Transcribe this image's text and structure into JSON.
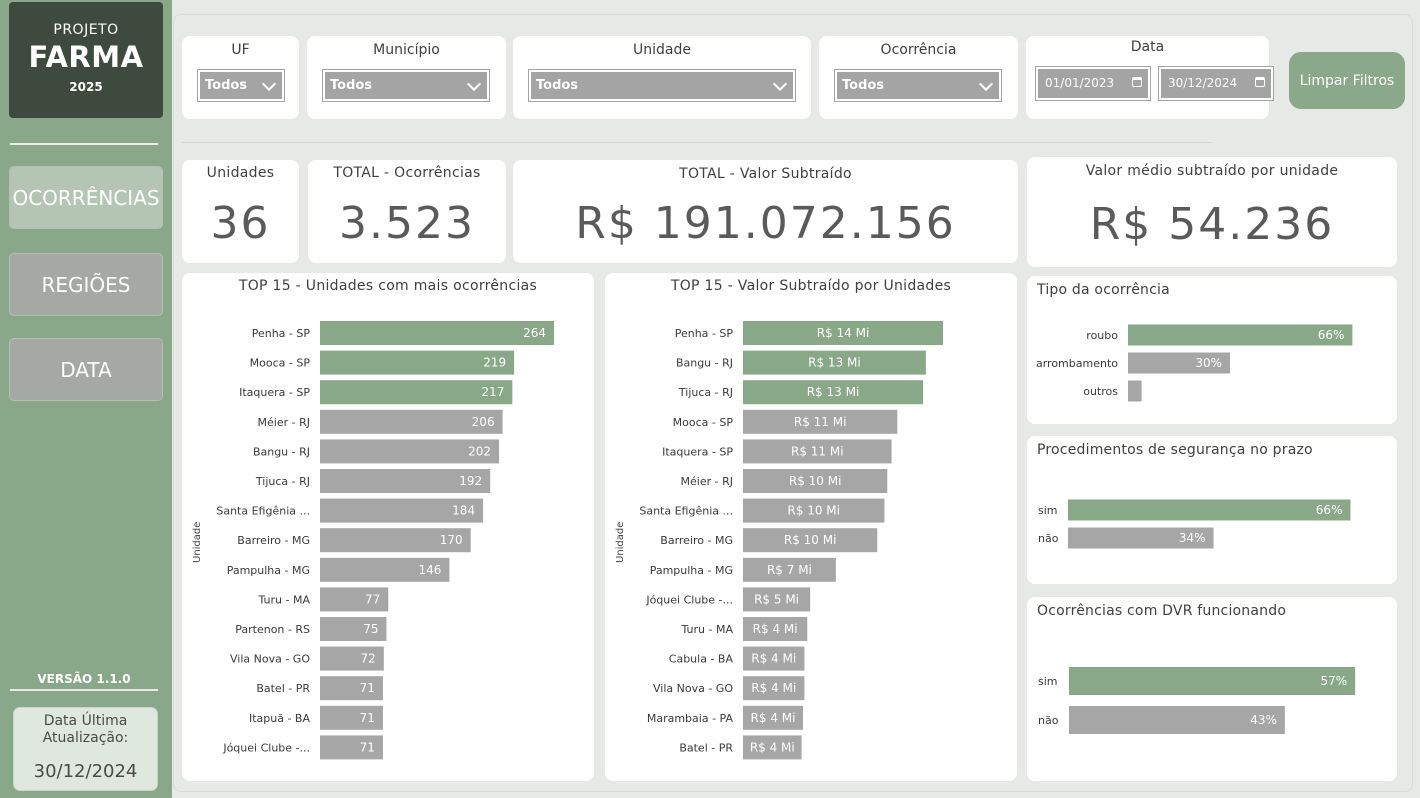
{
  "sidebar": {
    "logo": {
      "line1": "PROJETO",
      "line2": "FARMA",
      "line3": "2025"
    },
    "nav": [
      {
        "label": "OCORRÊNCIAS",
        "active": true
      },
      {
        "label": "REGIÕES",
        "active": false
      },
      {
        "label": "DATA",
        "active": false
      }
    ],
    "version": "VERSÃO 1.1.0",
    "update_label": "Data Última Atualização:",
    "update_date": "30/12/2024"
  },
  "filters": {
    "uf": {
      "label": "UF",
      "value": "Todos"
    },
    "municipio": {
      "label": "Município",
      "value": "Todos"
    },
    "unidade": {
      "label": "Unidade",
      "value": "Todos"
    },
    "ocorrencia": {
      "label": "Ocorrência",
      "value": "Todos"
    },
    "data": {
      "label": "Data",
      "start": "01/01/2023",
      "end": "30/12/2024"
    },
    "clear_label": "Limpar Filtros"
  },
  "kpis": {
    "unidades": {
      "title": "Unidades",
      "value": "36"
    },
    "ocorrencias": {
      "title": "TOTAL - Ocorrências",
      "value": "3.523"
    },
    "valor": {
      "title": "TOTAL - Valor Subtraído",
      "value": "R$ 191.072.156"
    },
    "media": {
      "title": "Valor médio subtraído por unidade",
      "value": "R$ 54.236"
    }
  },
  "colors": {
    "green": "#88a888",
    "gray": "#a6a6a6"
  },
  "chart_data": [
    {
      "type": "bar",
      "orientation": "horizontal",
      "title": "TOP 15 - Unidades com mais ocorrências",
      "ylabel": "Unidade",
      "categories": [
        "Penha - SP",
        "Mooca - SP",
        "Itaquera - SP",
        "Méier - RJ",
        "Bangu - RJ",
        "Tijuca - RJ",
        "Santa Efigênia ...",
        "Barreiro - MG",
        "Pampulha - MG",
        "Turu - MA",
        "Partenon - RS",
        "Vila Nova - GO",
        "Batel - PR",
        "Itapuã - BA",
        "Jóquei Clube -..."
      ],
      "values": [
        264,
        219,
        217,
        206,
        202,
        192,
        184,
        170,
        146,
        77,
        75,
        72,
        71,
        71,
        71
      ],
      "labels": [
        "264",
        "219",
        "217",
        "206",
        "202",
        "192",
        "184",
        "170",
        "146",
        "77",
        "75",
        "72",
        "71",
        "71",
        "71"
      ],
      "highlight_count": 3
    },
    {
      "type": "bar",
      "orientation": "horizontal",
      "title": "TOP 15 - Valor Subtraído por Unidades",
      "ylabel": "Unidade",
      "categories": [
        "Penha - SP",
        "Bangu - RJ",
        "Tijuca - RJ",
        "Mooca - SP",
        "Itaquera - SP",
        "Méier - RJ",
        "Santa Efigênia ...",
        "Barreiro - MG",
        "Pampulha - MG",
        "Jóquei Clube -...",
        "Turu - MA",
        "Cabula - BA",
        "Vila Nova - GO",
        "Marambaia - PA",
        "Batel - PR"
      ],
      "values": [
        14.0,
        12.8,
        12.6,
        10.8,
        10.4,
        10.1,
        9.9,
        9.4,
        6.5,
        4.7,
        4.5,
        4.3,
        4.3,
        4.2,
        4.1
      ],
      "labels": [
        "R$ 14 Mi",
        "R$ 13 Mi",
        "R$ 13 Mi",
        "R$ 11 Mi",
        "R$ 11 Mi",
        "R$ 10 Mi",
        "R$ 10 Mi",
        "R$ 10 Mi",
        "R$ 7 Mi",
        "R$ 5 Mi",
        "R$ 4 Mi",
        "R$ 4 Mi",
        "R$ 4 Mi",
        "R$ 4 Mi",
        "R$ 4 Mi"
      ],
      "unit": "R$ Mi",
      "highlight_count": 3
    },
    {
      "type": "bar",
      "orientation": "horizontal",
      "title": "Tipo da ocorrência",
      "categories": [
        "roubo",
        "arrombamento",
        "outros"
      ],
      "values": [
        66,
        30,
        4
      ],
      "labels": [
        "66%",
        "30%",
        ""
      ],
      "highlight_count": 1
    },
    {
      "type": "bar",
      "orientation": "horizontal",
      "title": "Procedimentos de segurança no prazo",
      "categories": [
        "sim",
        "não"
      ],
      "values": [
        66,
        34
      ],
      "labels": [
        "66%",
        "34%"
      ],
      "highlight_count": 1
    },
    {
      "type": "bar",
      "orientation": "horizontal",
      "title": "Ocorrências com DVR funcionando",
      "categories": [
        "sim",
        "não"
      ],
      "values": [
        57,
        43
      ],
      "labels": [
        "57%",
        "43%"
      ],
      "highlight_count": 1
    }
  ]
}
